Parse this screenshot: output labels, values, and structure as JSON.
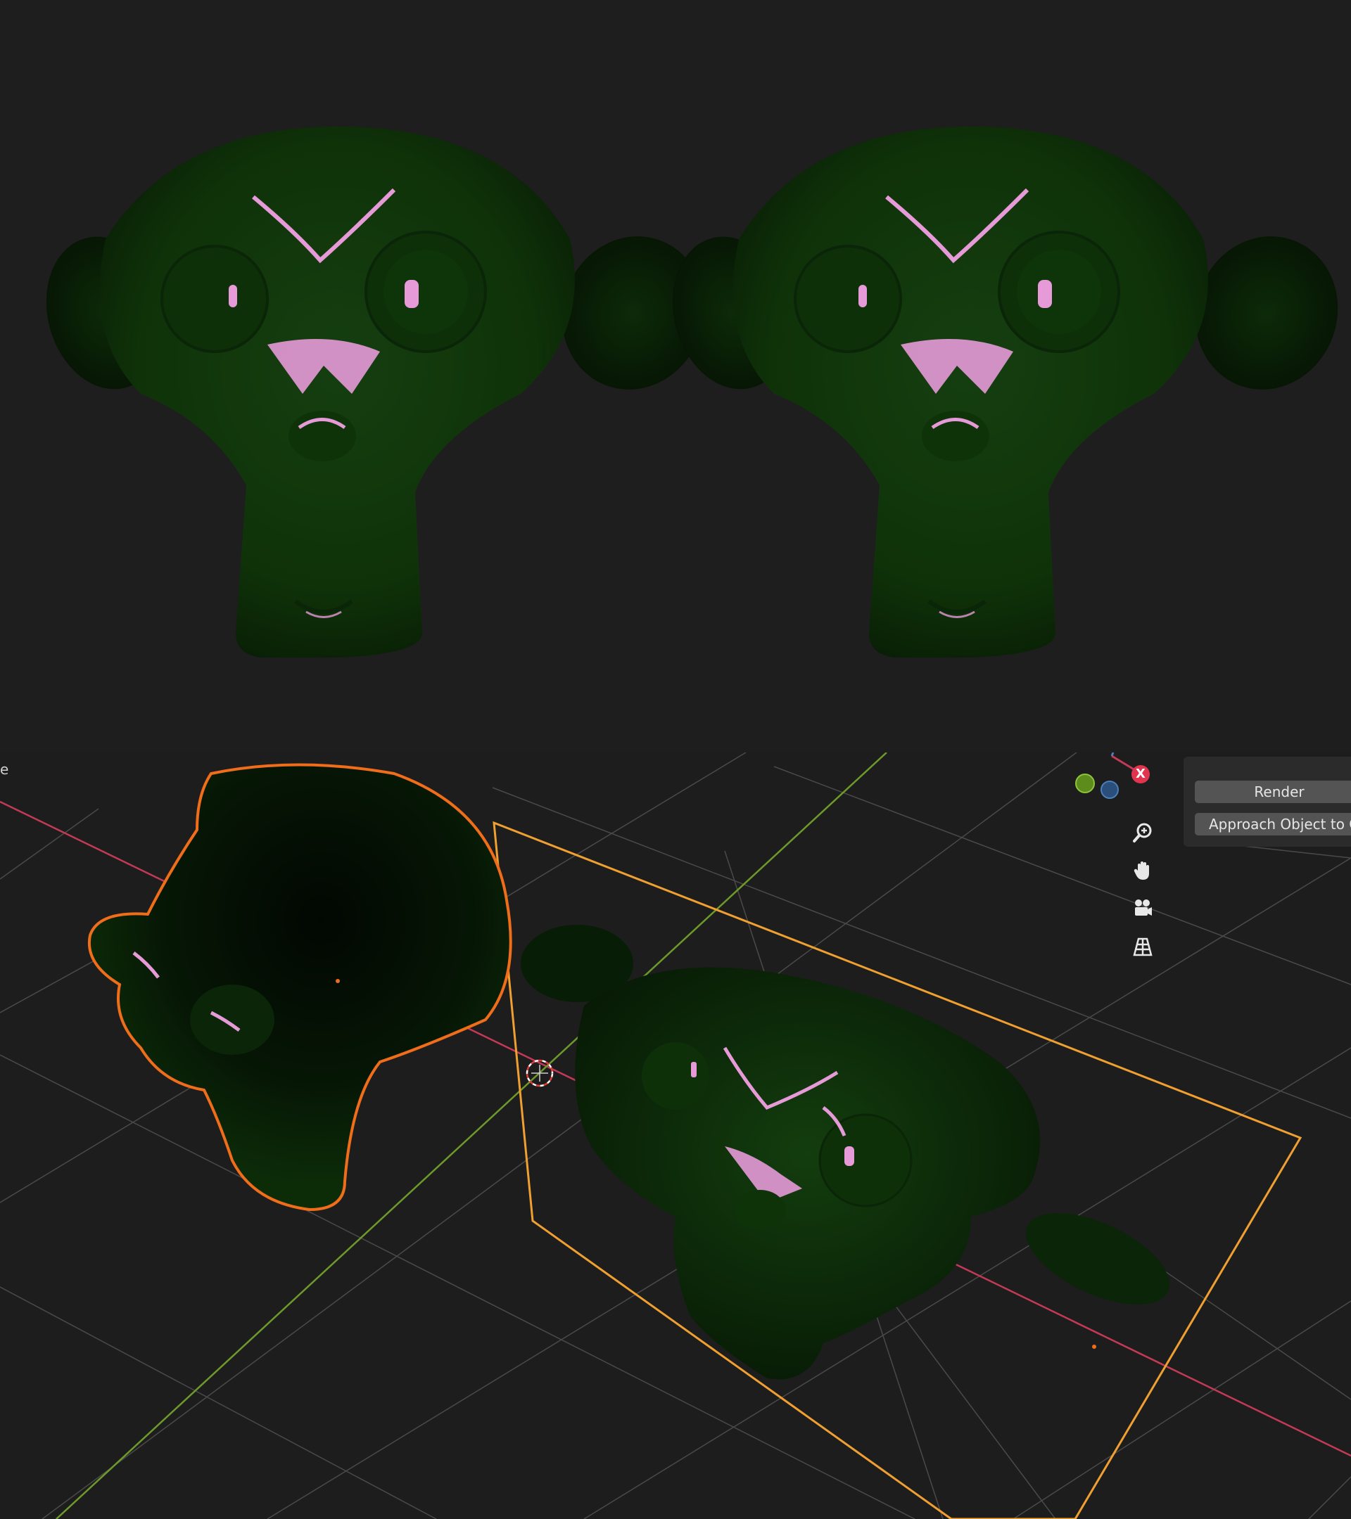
{
  "viewport": {
    "header_fragment": "e"
  },
  "navigation_gizmo": {
    "x_label": "X",
    "colors": {
      "x": "#e1344e",
      "y": "#8dc43a",
      "z": "#4a7fb8"
    }
  },
  "nav_tools": [
    {
      "name": "zoom",
      "icon": "zoom-icon"
    },
    {
      "name": "pan",
      "icon": "hand-icon"
    },
    {
      "name": "camera",
      "icon": "camera-icon"
    },
    {
      "name": "perspective",
      "icon": "grid-icon"
    }
  ],
  "sidebar": {
    "render_label": "Render",
    "approach_label": "Approach Object to C"
  },
  "colors": {
    "monkey_green": "#0f3a0b",
    "specular": "#e79ad8",
    "selection_outline": "#f06d1a",
    "camera_frame": "#f0a030",
    "axis_x": "#c43a56",
    "axis_y": "#6d9a2a"
  }
}
